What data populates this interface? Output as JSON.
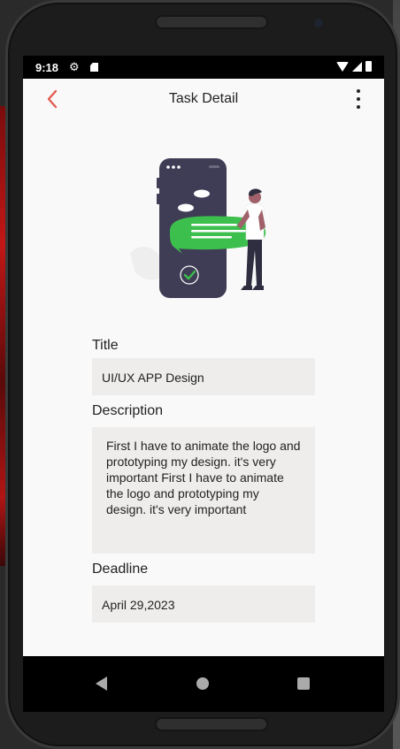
{
  "status_bar": {
    "time": "9:18",
    "icons": [
      "gear-icon",
      "sd-card-icon",
      "wifi-icon",
      "signal-icon",
      "battery-icon"
    ]
  },
  "app_bar": {
    "title": "Task Detail",
    "back_icon": "chevron-left-icon",
    "menu_icon": "more-vertical-icon"
  },
  "illustration": {
    "name": "person-with-phone-chat-illustration"
  },
  "form": {
    "title_label": "Title",
    "title_value": "UI/UX APP Design",
    "description_label": "Description",
    "description_value": "First I have to animate the logo and prototyping my design. it's very important First I have to animate the logo and prototyping my design. it's very important",
    "deadline_label": "Deadline",
    "deadline_value": "April 29,2023"
  },
  "nav_bar": {
    "icons": [
      "nav-back-icon",
      "nav-home-icon",
      "nav-recent-apps-icon"
    ]
  },
  "colors": {
    "accent": "#e35d50",
    "green": "#3cbf4d",
    "phone_dark": "#3f3d56",
    "field_bg": "#eeedec",
    "app_bg": "#f9f9f9"
  }
}
